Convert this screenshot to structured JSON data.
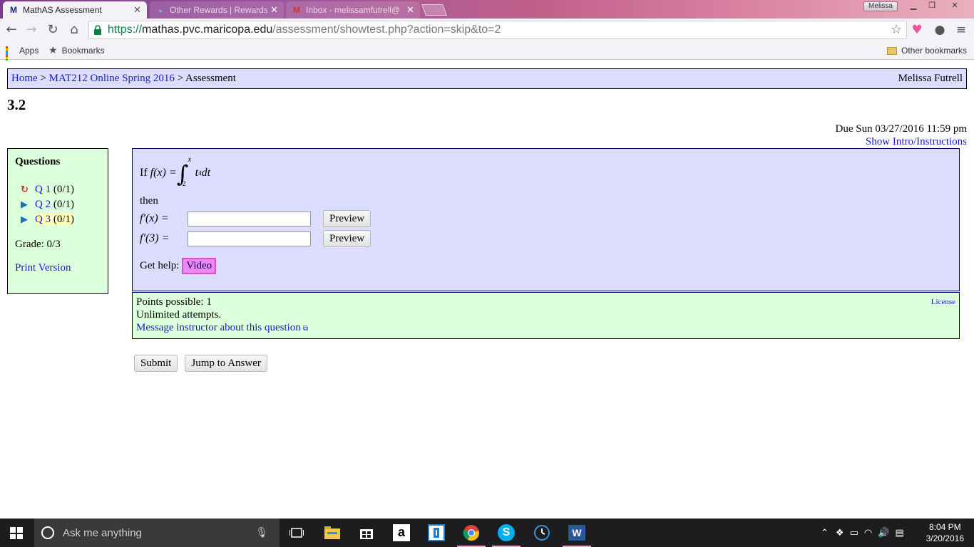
{
  "browser": {
    "tabs": [
      {
        "title": "MathAS Assessment",
        "active": true
      },
      {
        "title": "Other Rewards | Rewards",
        "active": false
      },
      {
        "title": "Inbox - melissamfutrell@",
        "active": false
      }
    ],
    "profile_name": "Melissa",
    "url": {
      "scheme": "https://",
      "host": "mathas.pvc.maricopa.edu",
      "path": "/assessment/showtest.php?action=skip&to=2"
    },
    "bookmarks": {
      "apps_label": "Apps",
      "bookmarks_label": "Bookmarks",
      "other_label": "Other bookmarks"
    }
  },
  "page": {
    "breadcrumb": {
      "home": "Home",
      "sep1": " > ",
      "course": "MAT212 Online Spring 2016",
      "sep2": " > ",
      "current": "Assessment"
    },
    "user_name": "Melissa Futrell",
    "assessment_title": "3.2",
    "due_text": "Due Sun 03/27/2016 11:59 pm",
    "show_intro_label": "Show Intro/Instructions",
    "questions_panel": {
      "heading": "Questions",
      "items": [
        {
          "label": "Q 1",
          "score": "(0/1)",
          "status": "retry"
        },
        {
          "label": "Q 2",
          "score": "(0/1)",
          "status": "untried"
        },
        {
          "label": "Q 3",
          "score": "(0/1)",
          "status": "current"
        }
      ],
      "grade_text": "Grade: 0/3",
      "print_version_label": "Print Version"
    },
    "question": {
      "prefix": "If",
      "lhs": "f(x) =",
      "integral_upper": "x",
      "integral_lower": "2",
      "integrand_base": "t",
      "integrand_exp": "4",
      "integrand_diff": "dt",
      "then_text": "then",
      "answers": [
        {
          "label": "f′(x) =",
          "value": "",
          "preview_label": "Preview"
        },
        {
          "label": "f′(3) =",
          "value": "",
          "preview_label": "Preview"
        }
      ],
      "get_help_label": "Get help:",
      "video_label": "Video"
    },
    "info": {
      "points": "Points possible: 1",
      "attempts": "Unlimited attempts.",
      "message_label": "Message instructor about this question",
      "license_label": "License"
    },
    "actions": {
      "submit_label": "Submit",
      "jump_label": "Jump to Answer"
    }
  },
  "taskbar": {
    "search_placeholder": "Ask me anything",
    "time": "8:04 PM",
    "date": "3/20/2016"
  },
  "colors": {
    "breadcrumb_bg": "#dcdcff",
    "question_bg": "#dcdcff",
    "panel_green": "#dcffdc",
    "link": "#1a1acc",
    "video_btn": "#ee88ee"
  }
}
